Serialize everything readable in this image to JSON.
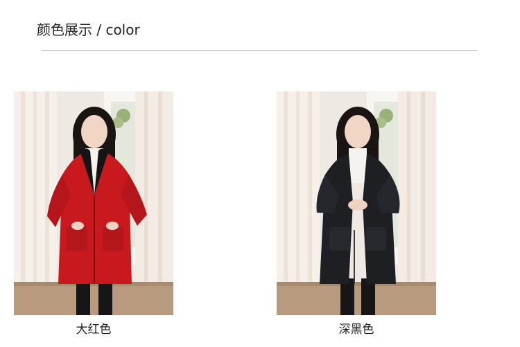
{
  "header": {
    "title": "颜色展示 / color"
  },
  "colors": [
    {
      "caption": "大红色",
      "swatch": "#c8191e",
      "trim": "#141414"
    },
    {
      "caption": "深黑色",
      "swatch": "#1d1f23",
      "trim": "#2a2c30"
    }
  ],
  "palette": {
    "background": "#ffffff",
    "text": "#222222",
    "divider": "#b0b0b0",
    "room_wall": "#efe9e3",
    "curtain": "#f6f0ea",
    "floor": "#b89a7e"
  }
}
